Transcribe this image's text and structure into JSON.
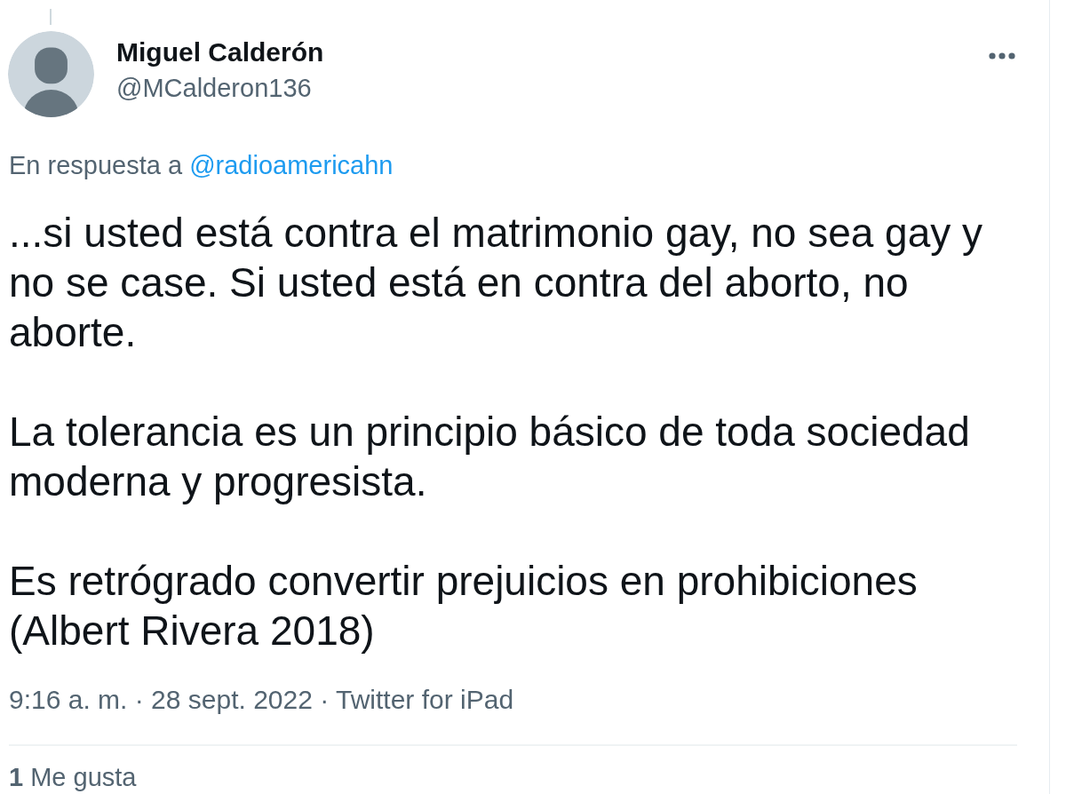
{
  "tweet": {
    "author": {
      "name": "Miguel Calderón",
      "handle": "@MCalderon136"
    },
    "reply_context": {
      "text": "En respuesta a",
      "mention": "@radioamericahn"
    },
    "text_paragraphs": [
      "...si usted está contra el matrimonio gay, no sea gay y no se case. Si usted está en contra del aborto, no aborte.",
      "La tolerancia es un principio básico de toda sociedad moderna y progresista.",
      "Es retrógrado convertir prejuicios en prohibiciones (Albert Rivera 2018)"
    ],
    "timestamp": "9:16 a. m. · 28 sept. 2022 · Twitter for iPad",
    "likes": "**1** Me gusta"
  }
}
